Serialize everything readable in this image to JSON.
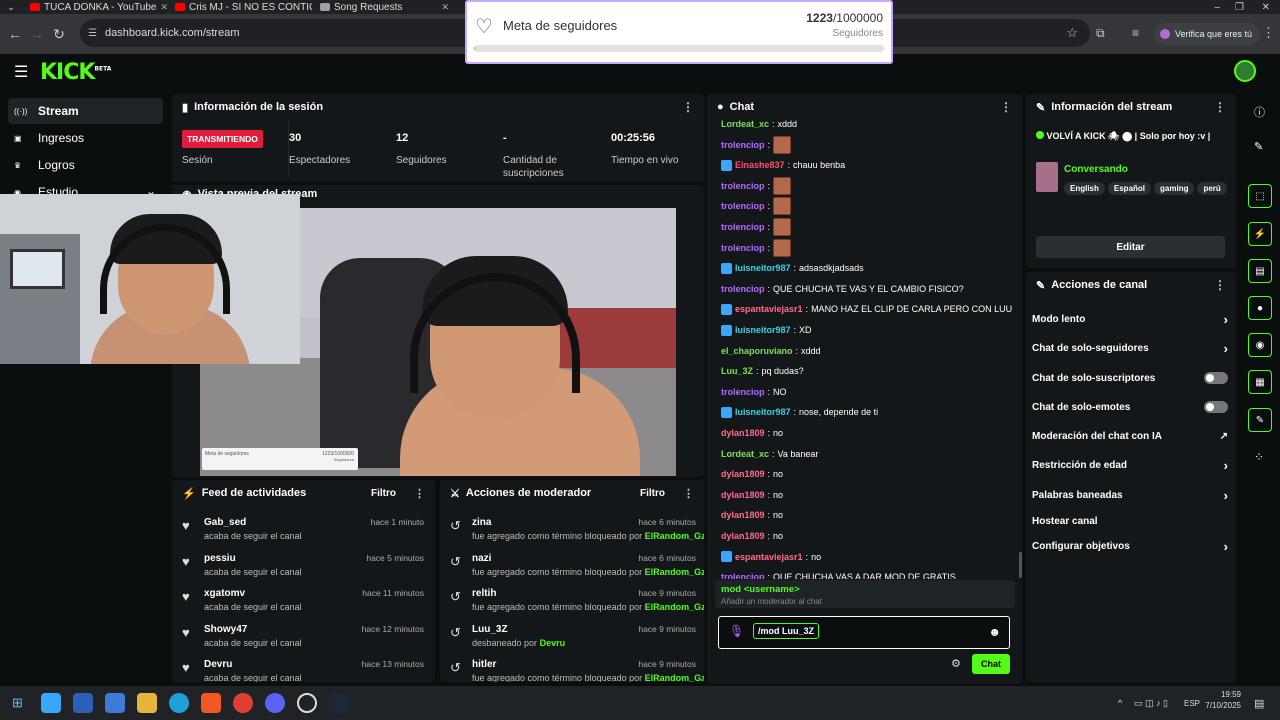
{
  "browser": {
    "tabs": [
      {
        "title": "TUCA DONKA - YouTube",
        "color": "#ff0000"
      },
      {
        "title": "Cris MJ - SI NO ES CONTIG",
        "color": "#ff0000"
      },
      {
        "title": "Song Requests",
        "color": "#9aa0a6"
      }
    ],
    "url": "dashboard.kick.com/stream",
    "verify_label": "Verifica que eres tú"
  },
  "goal": {
    "title": "Meta de seguidores",
    "current": "1223",
    "target": "/1000000",
    "unit": "Seguidores",
    "progress": 0.0012,
    "preview_title": "Meta de seguidores",
    "preview_count": "1223/1000000",
    "preview_unit": "Seguidores"
  },
  "brand": {
    "logo": "KICK",
    "beta": "BETA",
    "accent": "#53fc18"
  },
  "sidenav": [
    {
      "label": "Stream",
      "icon": "broadcast-icon",
      "glyph": "((·))",
      "active": true
    },
    {
      "label": "Ingresos",
      "icon": "money-icon",
      "glyph": "▣"
    },
    {
      "label": "Logros",
      "icon": "trophy-icon",
      "glyph": "♛"
    },
    {
      "label": "Estudio",
      "icon": "studio-icon",
      "glyph": "◉"
    }
  ],
  "session": {
    "title": "Información de la sesión",
    "status": "TRANSMITIENDO",
    "stats": [
      {
        "label": "Sesión",
        "value": ""
      },
      {
        "label": "Espectadores",
        "value": "30"
      },
      {
        "label": "Seguidores",
        "value": "12"
      },
      {
        "label": "Cantidad de suscripciones",
        "value": "-"
      },
      {
        "label": "Tiempo en vivo",
        "value": "00:25:56"
      }
    ]
  },
  "preview": {
    "title": "Vista previa del stream"
  },
  "feed": {
    "title": "Feed de actividades",
    "filter": "Filtro",
    "items": [
      {
        "name": "Gab_sed",
        "desc": "acaba de seguir el canal",
        "time": "hace 1 minuto"
      },
      {
        "name": "pessiu",
        "desc": "acaba de seguir el canal",
        "time": "hace 5 minutos"
      },
      {
        "name": "xgatomv",
        "desc": "acaba de seguir el canal",
        "time": "hace 11 minutos"
      },
      {
        "name": "Showy47",
        "desc": "acaba de seguir el canal",
        "time": "hace 12 minutos"
      },
      {
        "name": "Devru",
        "desc": "acaba de seguir el canal",
        "time": "hace 13 minutos"
      }
    ]
  },
  "mod": {
    "title": "Acciones de moderador",
    "filter": "Filtro",
    "items": [
      {
        "name": "zina",
        "desc": "fue agregado como término bloqueado por",
        "by": "ElRandom_Gz",
        "time": "hace 6 minutos"
      },
      {
        "name": "nazi",
        "desc": "fue agregado como término bloqueado por",
        "by": "ElRandom_Gz",
        "time": "hace 6 minutos"
      },
      {
        "name": "reltih",
        "desc": "fue agregado como término bloqueado por",
        "by": "ElRandom_Gz",
        "time": "hace 9 minutos"
      },
      {
        "name": "Luu_3Z",
        "desc": "desbaneado por",
        "by": "Devru",
        "time": "hace 9 minutos"
      },
      {
        "name": "hitler",
        "desc": "fue agregado como término bloqueado por",
        "by": "ElRandom_Gz",
        "time": "hace 9 minutos"
      }
    ]
  },
  "chat": {
    "title": "Chat",
    "messages": [
      {
        "user": "Lordeat_xc",
        "text": "xddd",
        "color": "#7ddf5a",
        "badge": false,
        "emote": false
      },
      {
        "user": "trolenciop",
        "text": "",
        "color": "#b26bff",
        "badge": false,
        "emote": true
      },
      {
        "user": "Einashe837",
        "text": "chauu benba",
        "color": "#ff4d6d",
        "badge": true,
        "emote": false
      },
      {
        "user": "trolenciop",
        "text": "",
        "color": "#b26bff",
        "badge": false,
        "emote": true
      },
      {
        "user": "trolenciop",
        "text": "",
        "color": "#b26bff",
        "badge": false,
        "emote": true
      },
      {
        "user": "trolenciop",
        "text": "",
        "color": "#b26bff",
        "badge": false,
        "emote": true
      },
      {
        "user": "trolenciop",
        "text": "",
        "color": "#b26bff",
        "badge": false,
        "emote": true
      },
      {
        "user": "luisneitor987",
        "text": "adsasdkjadsads",
        "color": "#3ad0e8",
        "badge": true,
        "emote": false
      },
      {
        "user": "trolenciop",
        "text": "QUE CHUCHA TE VAS Y EL CAMBIO FISICO?",
        "color": "#b26bff",
        "badge": false,
        "emote": false
      },
      {
        "user": "espantaviejasr1",
        "text": "MANO HAZ EL CLIP DE CARLA PERO CON LUU",
        "color": "#ff6b8a",
        "badge": true,
        "emote": false
      },
      {
        "user": "luisneitor987",
        "text": "XD",
        "color": "#3ad0e8",
        "badge": true,
        "emote": false
      },
      {
        "user": "el_chaporuviano",
        "text": "xddd",
        "color": "#7ddf5a",
        "badge": false,
        "emote": false
      },
      {
        "user": "Luu_3Z",
        "text": "pq dudas?",
        "color": "#7ddf5a",
        "badge": false,
        "emote": false
      },
      {
        "user": "trolenciop",
        "text": "NO",
        "color": "#b26bff",
        "badge": false,
        "emote": false
      },
      {
        "user": "luisneitor987",
        "text": "nose, depende de ti",
        "color": "#3ad0e8",
        "badge": true,
        "emote": false
      },
      {
        "user": "dylan1809",
        "text": "no",
        "color": "#ff6b8a",
        "badge": false,
        "emote": false
      },
      {
        "user": "Lordeat_xc",
        "text": "Va banear",
        "color": "#7ddf5a",
        "badge": false,
        "emote": false
      },
      {
        "user": "dylan1809",
        "text": "no",
        "color": "#ff6b8a",
        "badge": false,
        "emote": false
      },
      {
        "user": "dylan1809",
        "text": "no",
        "color": "#ff6b8a",
        "badge": false,
        "emote": false
      },
      {
        "user": "dylan1809",
        "text": "no",
        "color": "#ff6b8a",
        "badge": false,
        "emote": false
      },
      {
        "user": "dylan1809",
        "text": "no",
        "color": "#ff6b8a",
        "badge": false,
        "emote": false
      },
      {
        "user": "espantaviejasr1",
        "text": "no",
        "color": "#ff6b8a",
        "badge": true,
        "emote": false
      },
      {
        "user": "trolenciop",
        "text": "QUE CHUCHA VAS A DAR MOD DE GRATIS",
        "color": "#b26bff",
        "badge": false,
        "emote": false
      }
    ],
    "suggest_cmd": "mod <username>",
    "suggest_desc": "Añadir un moderador al chat",
    "input_value": "/mod Luu_3Z",
    "send_label": "Chat"
  },
  "stream_info": {
    "title": "Información del stream",
    "stream_title": "VOLVÍ A KICK 🕷 ⬤ | Solo por hoy :v |",
    "category": "Conversando",
    "tags": [
      "English",
      "Español",
      "gaming",
      "perú"
    ],
    "edit_label": "Editar"
  },
  "channel": {
    "title": "Acciones de canal",
    "items": [
      {
        "label": "Modo lento",
        "kind": "arrow"
      },
      {
        "label": "Chat de solo-seguidores",
        "kind": "arrow"
      },
      {
        "label": "Chat de solo-suscriptores",
        "kind": "toggle"
      },
      {
        "label": "Chat de solo-emotes",
        "kind": "toggle"
      },
      {
        "label": "Moderación del chat con IA",
        "kind": "external"
      },
      {
        "label": "Restricción de edad",
        "kind": "arrow"
      },
      {
        "label": "Palabras baneadas",
        "kind": "arrow"
      },
      {
        "label": "Hostear canal",
        "kind": "none"
      },
      {
        "label": "Configurar objetivos",
        "kind": "arrow"
      }
    ]
  },
  "taskbar": {
    "lang": "ESP",
    "time": "19:59",
    "date": "7/10/2025"
  }
}
